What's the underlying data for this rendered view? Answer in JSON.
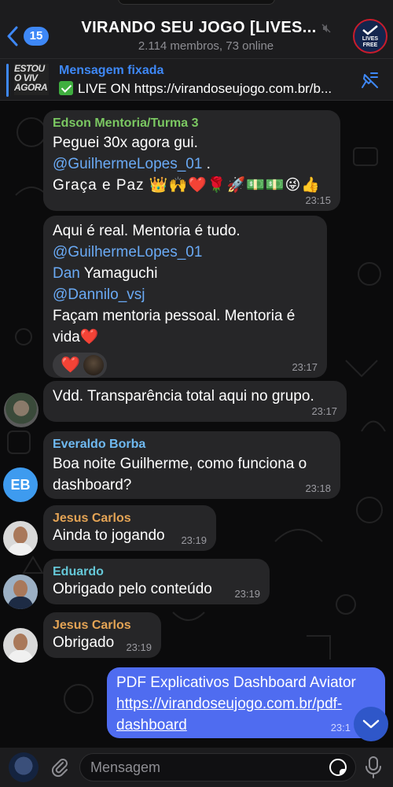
{
  "header": {
    "back_count": "15",
    "title": "VIRANDO SEU JOGO [LIVES...",
    "subtitle": "2.114 membros, 73 online",
    "avatar_text": "LIVES FREE"
  },
  "pinned": {
    "label": "Mensagem fixada",
    "text": "LIVE ON https://virandoseujogo.com.br/b...",
    "thumb_lines": [
      "ESTOU",
      "O VIV",
      "AGORA"
    ]
  },
  "messages": [
    {
      "sender": "Edson Mentoria/Turma 3",
      "sender_color": "#7bc862",
      "line1": "Peguei 30x agora gui.",
      "mention": "@GuilhermeLopes_01",
      "mention_suffix": " .",
      "line3": "Graça e Paz ",
      "emojis": "👑🙌❤️🌹🚀💵💵😜👍",
      "time": "23:15"
    },
    {
      "line1": "Aqui é real. Mentoria é tudo.",
      "mention1": "@GuilhermeLopes_01",
      "mention2_link": "Dan",
      "mention2_rest": " Yamaguchi",
      "mention3": "@Dannilo_vsj",
      "line5": "Façam mentoria pessoal. Mentoria é",
      "line6": "vida",
      "heart": "❤️",
      "reaction": "❤️",
      "time": "23:17"
    },
    {
      "text": "Vdd. Transparência total aqui no grupo.",
      "time": "23:17"
    },
    {
      "sender": "Everaldo Borba",
      "sender_color": "#6fb9f0",
      "line1": "Boa noite Guilherme, como funciona o",
      "line2": "dashboard?",
      "avatar_initials": "EB",
      "time": "23:18"
    },
    {
      "sender": "Jesus Carlos",
      "sender_color": "#e4a455",
      "text": "Ainda to jogando",
      "time": "23:19"
    },
    {
      "sender": "Eduardo",
      "sender_color": "#65c7d7",
      "text": "Obrigado pelo conteúdo",
      "time": "23:19"
    },
    {
      "sender": "Jesus Carlos",
      "sender_color": "#e4a455",
      "text": "Obrigado",
      "time": "23:19"
    },
    {
      "line1": "PDF Explicativos Dashboard Aviator",
      "link1": "https://virandoseujogo.com.br/pdf-",
      "link2": "dashboard",
      "time": "23:1"
    }
  ],
  "input": {
    "placeholder": "Mensagem"
  },
  "colors": {
    "accent": "#3e88f7",
    "outgoing_bubble": "#4f6cf0",
    "incoming_bubble": "#262628"
  }
}
